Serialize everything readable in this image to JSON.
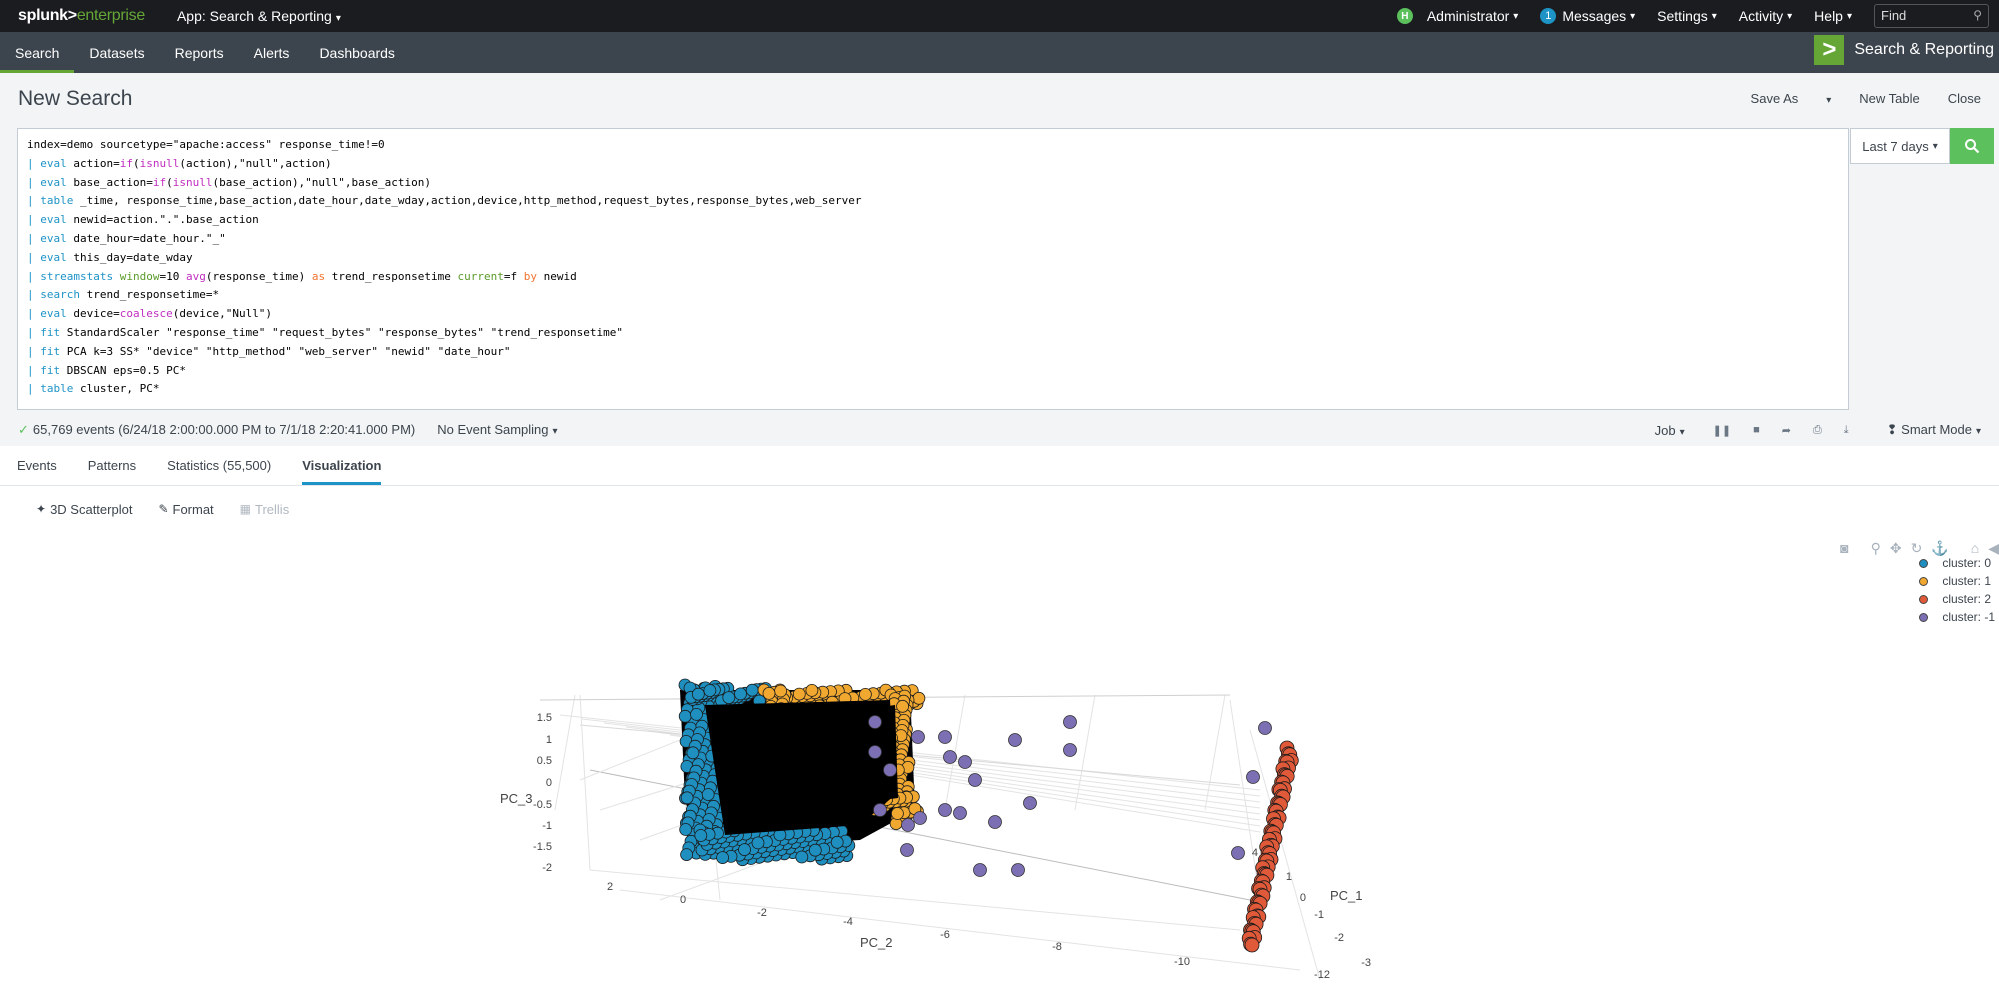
{
  "topbar": {
    "brand_main": "splunk>",
    "brand_sub": "enterprise",
    "app_menu": "App: Search & Reporting",
    "user_initial": "H",
    "user": "Administrator",
    "messages_count": "1",
    "messages": "Messages",
    "settings": "Settings",
    "activity": "Activity",
    "help": "Help",
    "find_placeholder": "Find"
  },
  "nav": {
    "tabs": [
      "Search",
      "Datasets",
      "Reports",
      "Alerts",
      "Dashboards"
    ],
    "app_name": "Search & Reporting"
  },
  "page": {
    "title": "New Search",
    "save_as": "Save As",
    "new_table": "New Table",
    "close": "Close"
  },
  "search": {
    "lines": [
      "index=demo sourcetype=\"apache:access\" response_time!=0",
      "| eval action=if(isnull(action),\"null\",action)",
      "| eval base_action=if(isnull(base_action),\"null\",base_action)",
      "| table _time, response_time,base_action,date_hour,date_wday,action,device,http_method,request_bytes,response_bytes,web_server",
      "| eval newid=action.\".\".base_action",
      "| eval date_hour=date_hour.\"_\"",
      "| eval this_day=date_wday",
      "| streamstats window=10 avg(response_time) as trend_responsetime current=f by newid",
      "| search trend_responsetime=*",
      "| eval device=coalesce(device,\"Null\")",
      "| fit StandardScaler \"response_time\" \"request_bytes\" \"response_bytes\" \"trend_responsetime\"",
      "| fit PCA k=3 SS* \"device\" \"http_method\" \"web_server\" \"newid\" \"date_hour\"",
      "| fit DBSCAN eps=0.5 PC*",
      "| table cluster, PC*"
    ],
    "time_range": "Last 7 days"
  },
  "status": {
    "events": "65,769 events (6/24/18 2:00:00.000 PM to 7/1/18 2:20:41.000 PM)",
    "sampling": "No Event Sampling",
    "job": "Job",
    "mode": "Smart Mode"
  },
  "result_tabs": [
    "Events",
    "Patterns",
    "Statistics (55,500)",
    "Visualization"
  ],
  "viz_toolbar": {
    "type": "3D Scatterplot",
    "format": "Format",
    "trellis": "Trellis"
  },
  "legend": [
    {
      "label": "cluster: 0",
      "color": "#1f8fc0"
    },
    {
      "label": "cluster: 1",
      "color": "#f0a830"
    },
    {
      "label": "cluster: 2",
      "color": "#e05a3a"
    },
    {
      "label": "cluster: -1",
      "color": "#7d6fb3"
    }
  ],
  "chart_data": {
    "type": "scatter",
    "dimensions": "3d",
    "x_axis": {
      "label": "PC_1",
      "ticks": [
        "1",
        "0",
        "-1",
        "-2",
        "-3"
      ]
    },
    "y_axis": {
      "label": "PC_2",
      "ticks": [
        "2",
        "0",
        "-2",
        "-4",
        "-6",
        "-8",
        "-10",
        "-12"
      ]
    },
    "z_axis": {
      "label": "PC_3",
      "ticks": [
        "1.5",
        "1",
        "0.5",
        "0",
        "-0.5",
        "-1",
        "-1.5",
        "-2"
      ]
    },
    "extra_tick": "4",
    "series": [
      {
        "name": "cluster: 0",
        "color": "#1f8fc0"
      },
      {
        "name": "cluster: 1",
        "color": "#f0a830"
      },
      {
        "name": "cluster: 2",
        "color": "#e05a3a"
      },
      {
        "name": "cluster: -1",
        "color": "#7d6fb3"
      }
    ]
  }
}
